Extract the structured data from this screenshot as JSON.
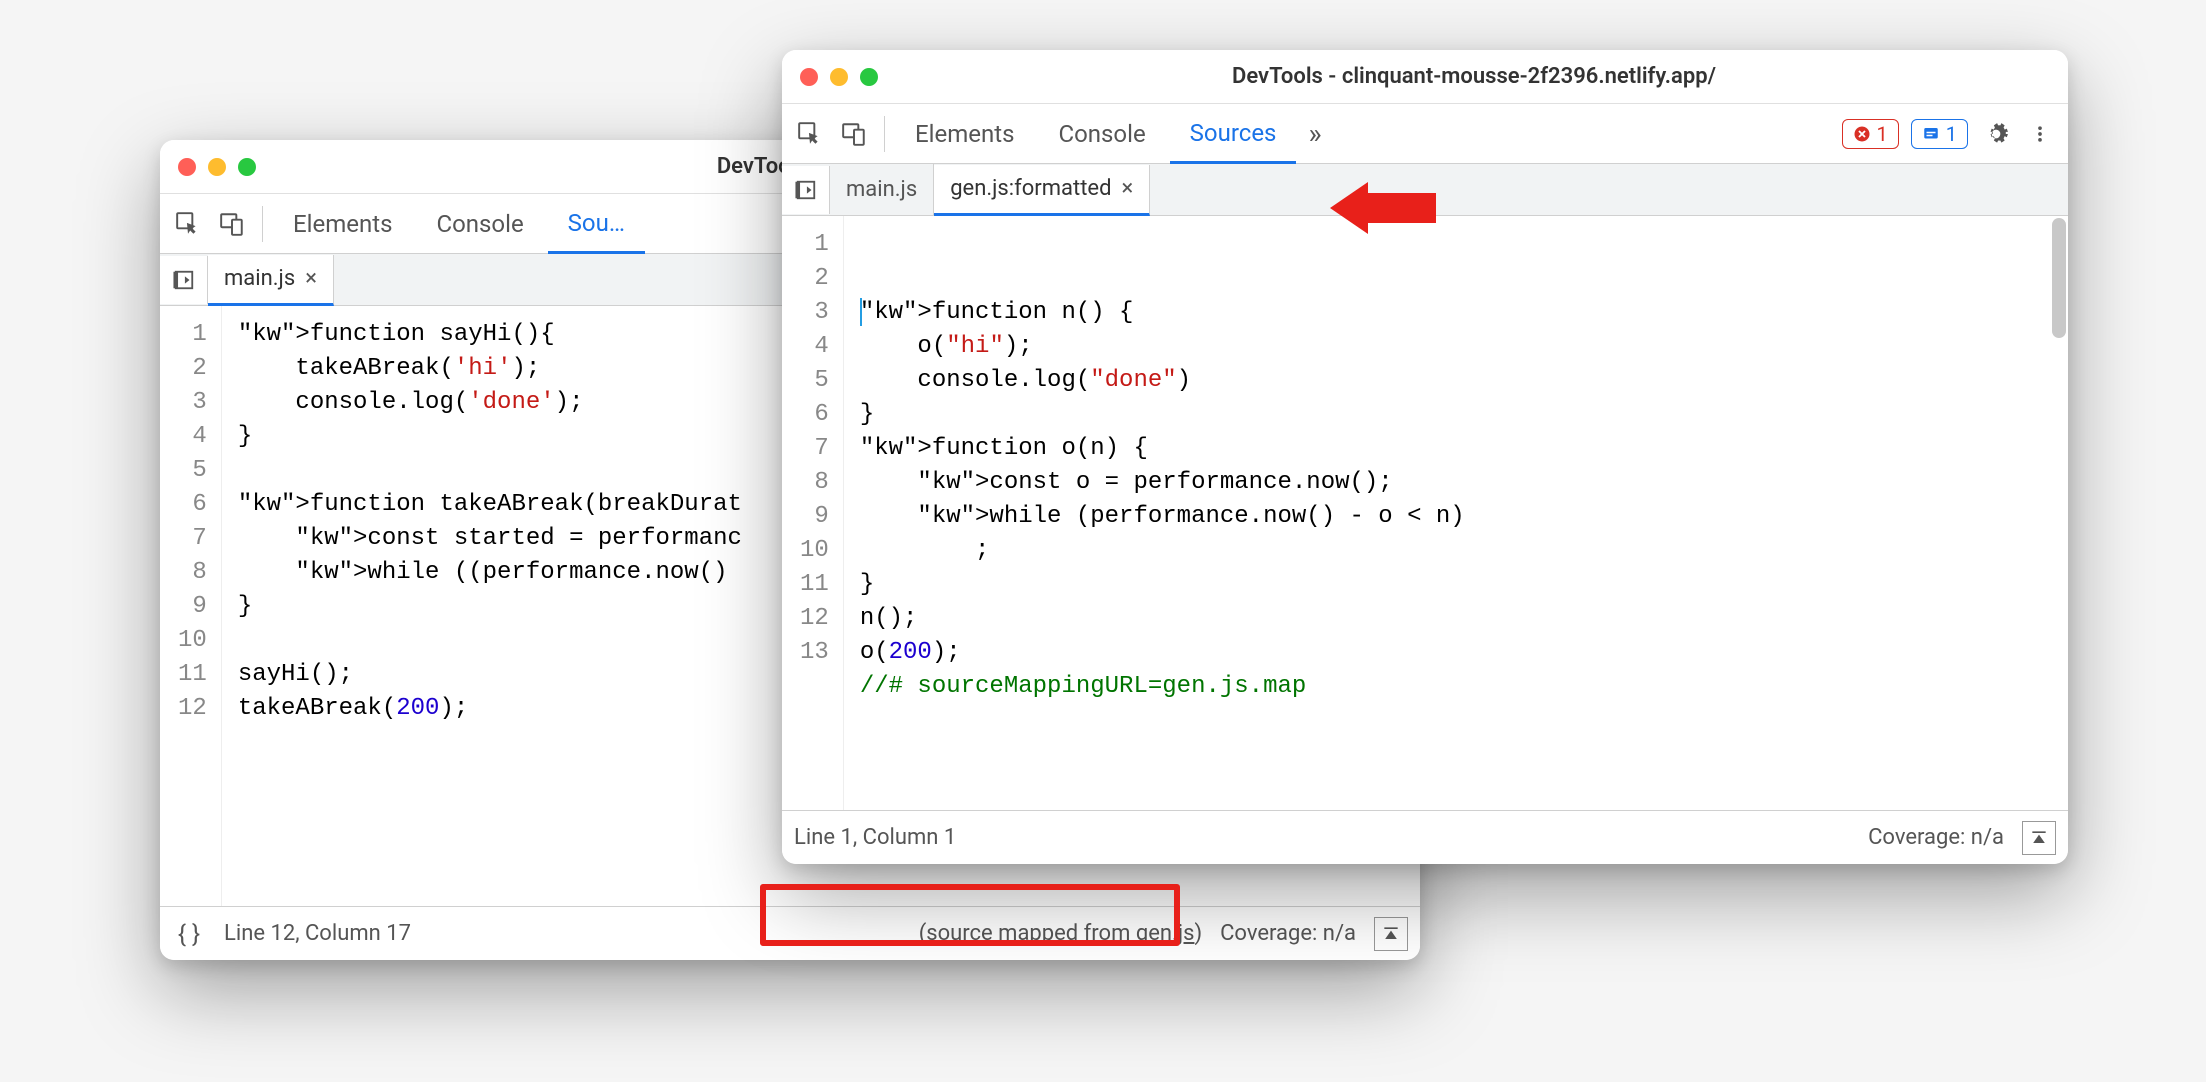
{
  "back": {
    "title": "DevTools - clinquant-m…",
    "tabs": {
      "elements": "Elements",
      "console": "Console",
      "sources": "Sou…"
    },
    "file_tabs": {
      "main": "main.js"
    },
    "code_lines": [
      "function sayHi(){",
      "    takeABreak('hi');",
      "    console.log('done');",
      "}",
      "",
      "function takeABreak(breakDurat",
      "    const started = performanc",
      "    while ((performance.now() ",
      "}",
      "",
      "sayHi();",
      "takeABreak(200);"
    ],
    "status": {
      "pretty": "{ }",
      "position": "Line 12, Column 17",
      "mapped_prefix": "(source mapped from ",
      "mapped_link": "gen.js",
      "mapped_suffix": ")",
      "coverage": "Coverage: n/a"
    }
  },
  "front": {
    "title": "DevTools - clinquant-mousse-2f2396.netlify.app/",
    "tabs": {
      "elements": "Elements",
      "console": "Console",
      "sources": "Sources"
    },
    "more_tabs": "»",
    "badges": {
      "err": "1",
      "info": "1"
    },
    "file_tabs": {
      "main": "main.js",
      "gen": "gen.js:formatted"
    },
    "code_lines": [
      "function n() {",
      "    o(\"hi\");",
      "    console.log(\"done\")",
      "}",
      "function o(n) {",
      "    const o = performance.now();",
      "    while (performance.now() - o < n)",
      "        ;",
      "}",
      "n();",
      "o(200);",
      "//# sourceMappingURL=gen.js.map",
      ""
    ],
    "status": {
      "position": "Line 1, Column 1",
      "coverage": "Coverage: n/a"
    }
  }
}
